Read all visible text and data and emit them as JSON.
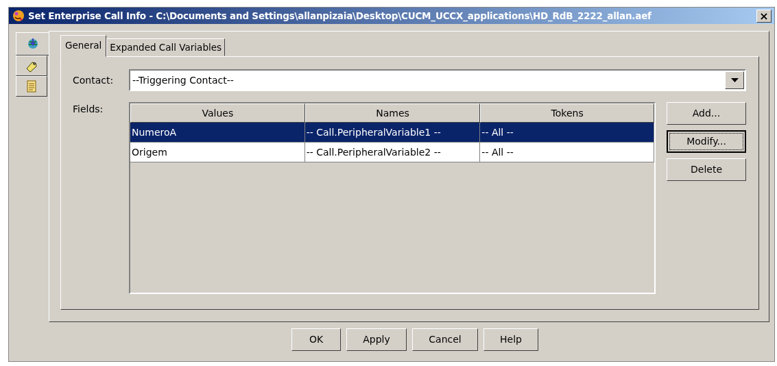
{
  "window": {
    "title": "Set Enterprise Call Info - C:\\Documents and Settings\\allanpizaia\\Desktop\\CUCM_UCCX_applications\\HD_RdB_2222_allan.aef",
    "close": "×"
  },
  "side_tabs": [
    {
      "kind": "globe",
      "selected": true
    },
    {
      "kind": "tag",
      "selected": false
    },
    {
      "kind": "note",
      "selected": false
    }
  ],
  "tabs": [
    {
      "label": "General",
      "selected": true
    },
    {
      "label": "Expanded Call Variables",
      "selected": false
    }
  ],
  "contact": {
    "label": "Contact:",
    "value": "--Triggering Contact--"
  },
  "fields": {
    "label": "Fields:",
    "columns": [
      "Values",
      "Names",
      "Tokens"
    ],
    "rows": [
      {
        "cells": [
          "NumeroA",
          "-- Call.PeripheralVariable1 --",
          "-- All --"
        ],
        "selected": true
      },
      {
        "cells": [
          "Origem",
          "-- Call.PeripheralVariable2 --",
          "-- All --"
        ],
        "selected": false
      }
    ]
  },
  "side_buttons": [
    {
      "label": "Add...",
      "focused": false
    },
    {
      "label": "Modify...",
      "focused": true
    },
    {
      "label": "Delete",
      "focused": false
    }
  ],
  "buttons": [
    "OK",
    "Apply",
    "Cancel",
    "Help"
  ]
}
